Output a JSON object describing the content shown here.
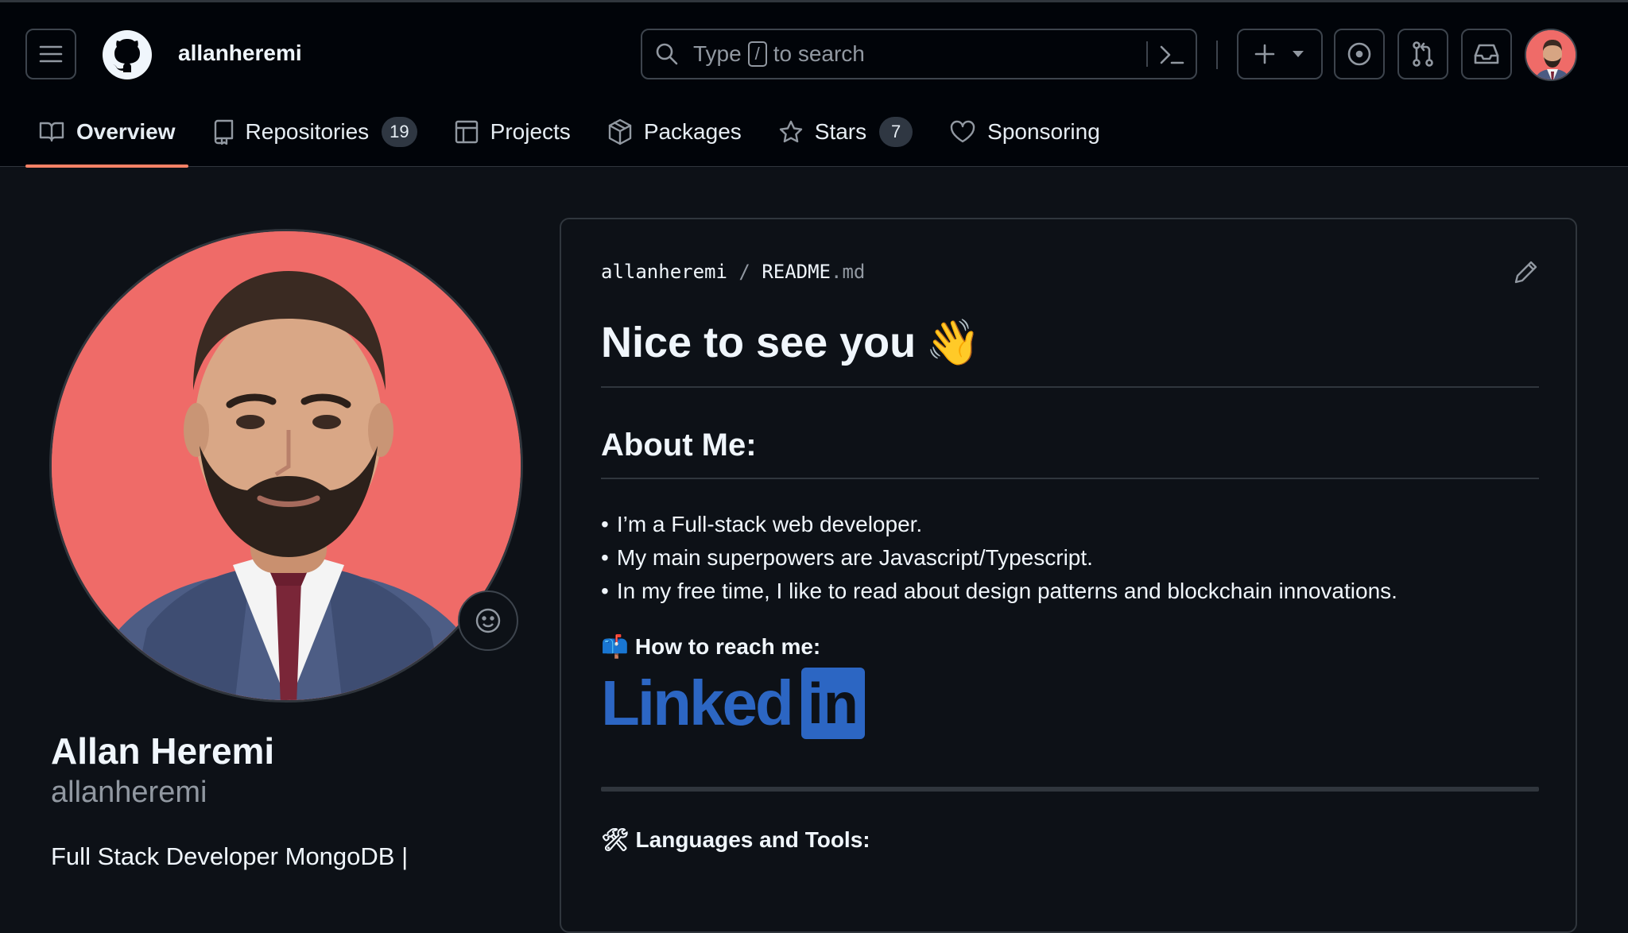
{
  "header": {
    "username": "allanheremi",
    "search": {
      "prefix": "Type",
      "key": "/",
      "suffix": "to search"
    }
  },
  "tabs": [
    {
      "label": "Overview",
      "icon": "book-icon",
      "active": true
    },
    {
      "label": "Repositories",
      "icon": "repo-icon",
      "count": "19"
    },
    {
      "label": "Projects",
      "icon": "table-icon"
    },
    {
      "label": "Packages",
      "icon": "package-icon"
    },
    {
      "label": "Stars",
      "icon": "star-icon",
      "count": "7"
    },
    {
      "label": "Sponsoring",
      "icon": "heart-icon"
    }
  ],
  "profile": {
    "full_name": "Allan Heremi",
    "login": "allanheremi",
    "bio": "Full Stack Developer MongoDB |"
  },
  "readme": {
    "owner": "allanheremi",
    "file_base": "README",
    "file_ext": ".md",
    "title": "Nice to see you",
    "title_emoji": "👋",
    "about_heading": "About Me:",
    "about_items": [
      "I’m a Full-stack web developer.",
      "My main superpowers are Javascript/Typescript.",
      "In my free time, I like to read about design patterns and blockchain innovations."
    ],
    "reach_emoji": "📫",
    "reach_heading": "How to reach me:",
    "linkedin_word": "Linked",
    "linkedin_box": "in",
    "tools_emoji": "🛠",
    "tools_heading": "Languages and Tools:"
  },
  "colors": {
    "accent_underline": "#f78166",
    "linkedin_blue": "#2c66c3",
    "avatar_background": "#ef6b68"
  }
}
